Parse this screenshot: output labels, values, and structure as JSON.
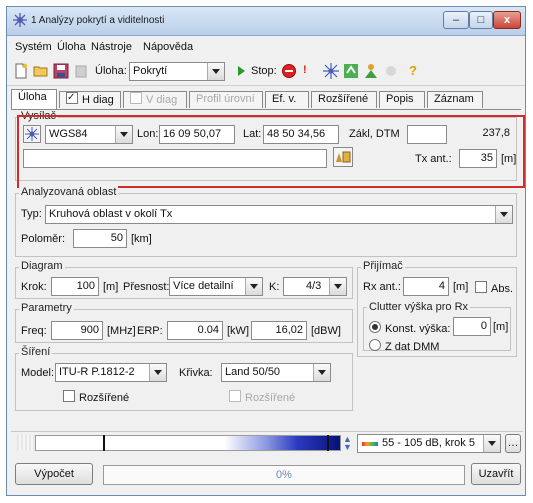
{
  "window": {
    "title": "1 Analýzy pokrytí a viditelnosti",
    "minimize": "–",
    "maximize": "□",
    "close": "x"
  },
  "menu": [
    "Systém",
    "Úloha",
    "Nástroje",
    "Nápověda"
  ],
  "toolbar": {
    "uloha_label": "Úloha:",
    "uloha_value": "Pokrytí",
    "stop_label": "Stop:",
    "warn": "!",
    "help": "?"
  },
  "tabs": [
    {
      "label": "Úloha",
      "state": "active"
    },
    {
      "label": "H diag",
      "checked": true
    },
    {
      "label": "V diag",
      "checked": false,
      "disabled": true
    },
    {
      "label": "Profil úrovní",
      "disabled": true
    },
    {
      "label": "Ef. v."
    },
    {
      "label": "Rozšířené"
    },
    {
      "label": "Popis"
    },
    {
      "label": "Záznam"
    }
  ],
  "vysilac": {
    "group_label": "Vysílač",
    "datum": "WGS84",
    "lon_label": "Lon:",
    "lon": "16 09 50,07",
    "lat_label": "Lat:",
    "lat": "48 50 34,56",
    "zakl_label": "Zákl, DTM",
    "zakl_value": "",
    "dtm_value": "237,8",
    "name_value": "",
    "tx_label": "Tx ant.:",
    "tx_value": "35",
    "tx_unit": "[m]"
  },
  "oblast": {
    "group_label": "Analyzovaná oblast",
    "typ_label": "Typ:",
    "typ_value": "Kruhová oblast v okolí Tx",
    "polomer_label": "Poloměr:",
    "polomer_value": "50",
    "polomer_unit": "[km]"
  },
  "diagram": {
    "group_label": "Diagram",
    "krok_label": "Krok:",
    "krok_value": "100",
    "krok_unit": "[m]",
    "presnost_label": "Přesnost:",
    "presnost_value": "Více detailní",
    "k_label": "K:",
    "k_value": "4/3"
  },
  "parametry": {
    "group_label": "Parametry",
    "freq_label": "Freq:",
    "freq_value": "900",
    "freq_unit": "[MHz]",
    "erp_label": "ERP:",
    "erp_value": "0.04",
    "erp_unit": "[kW]",
    "dbw_value": "16,02",
    "dbw_unit": "[dBW]"
  },
  "sireni": {
    "group_label": "Šíření",
    "model_label": "Model:",
    "model_value": "ITU-R P.1812-2",
    "krivka_label": "Křivka:",
    "krivka_value": "Land 50/50",
    "rozsirene1": "Rozšířené",
    "rozsirene2": "Rozšířené"
  },
  "prijimac": {
    "group_label": "Přijímač",
    "rx_label": "Rx ant.:",
    "rx_value": "4",
    "rx_unit": "[m]",
    "abs_label": "Abs.",
    "clutter_label": "Clutter výška pro Rx",
    "konst_label": "Konst. výška:",
    "konst_value": "0",
    "konst_unit": "[m]",
    "zdat_label": "Z dat DMM"
  },
  "scale": {
    "value": "55 - 105 dB, krok 5"
  },
  "bottom": {
    "calc_label": "Výpočet",
    "progress_text": "0%",
    "progress": 0,
    "close_label": "Uzavřít"
  }
}
